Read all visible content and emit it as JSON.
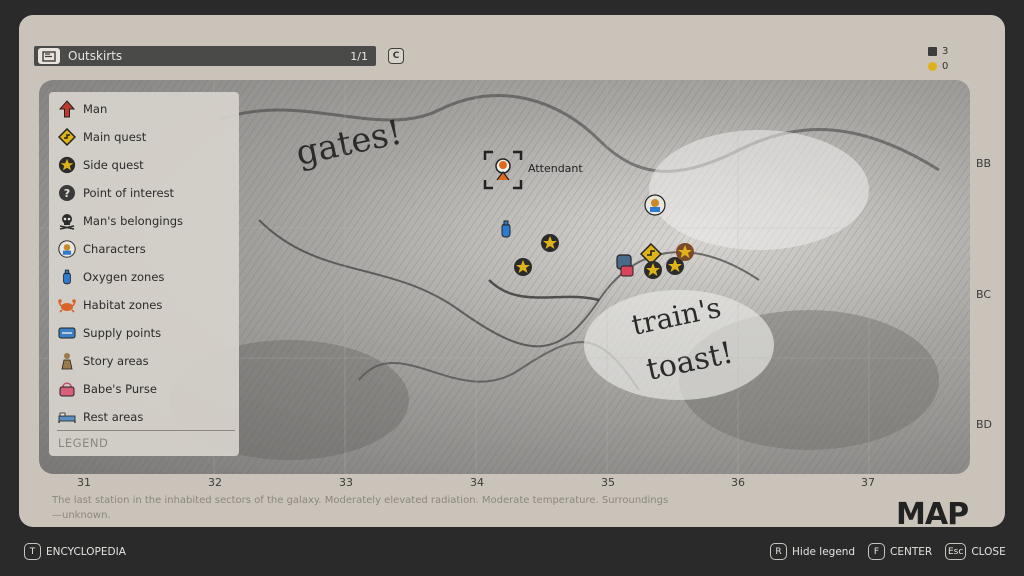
{
  "header": {
    "title": "Outskirts",
    "count": "1/1",
    "toggle_key": "C"
  },
  "resources": [
    {
      "icon": "film-icon",
      "value": "3",
      "color": "#3c3c3c"
    },
    {
      "icon": "radiation-icon",
      "value": "0",
      "color": "#e0b21a"
    }
  ],
  "legend": {
    "title": "LEGEND",
    "items": [
      {
        "label": "Man",
        "icon": "arrow-up-icon"
      },
      {
        "label": "Main quest",
        "icon": "main-quest-icon"
      },
      {
        "label": "Side quest",
        "icon": "star-icon"
      },
      {
        "label": "Point of interest",
        "icon": "question-icon"
      },
      {
        "label": "Man's belongings",
        "icon": "skull-icon"
      },
      {
        "label": "Characters",
        "icon": "character-icon"
      },
      {
        "label": "Oxygen zones",
        "icon": "oxygen-icon"
      },
      {
        "label": "Habitat zones",
        "icon": "crab-icon"
      },
      {
        "label": "Supply points",
        "icon": "supply-icon"
      },
      {
        "label": "Story areas",
        "icon": "story-icon"
      },
      {
        "label": "Babe's Purse",
        "icon": "purse-icon"
      },
      {
        "label": "Rest areas",
        "icon": "bed-icon"
      }
    ]
  },
  "map": {
    "graffiti_1": "gates!",
    "graffiti_2": "train's",
    "graffiti_3": "toast!",
    "tracked_label": "Attendant"
  },
  "axis": {
    "x": [
      "31",
      "32",
      "33",
      "34",
      "35",
      "36",
      "37"
    ],
    "y": [
      "BB",
      "BC",
      "BD"
    ]
  },
  "description": "The last station in the inhabited sectors of the galaxy. Moderately elevated radiation. Moderate temperature. Surroundings—unknown.",
  "page_title": "MAP",
  "footer": {
    "encyclopedia": {
      "key": "T",
      "label": "ENCYCLOPEDIA"
    },
    "hide_legend": {
      "key": "R",
      "label": "Hide legend"
    },
    "center": {
      "key": "F",
      "label": "CENTER"
    },
    "close": {
      "key": "Esc",
      "label": "CLOSE"
    }
  },
  "colors": {
    "accent": "#e0b21a",
    "danger": "#c0392b",
    "oxygen": "#2e7ad1"
  }
}
